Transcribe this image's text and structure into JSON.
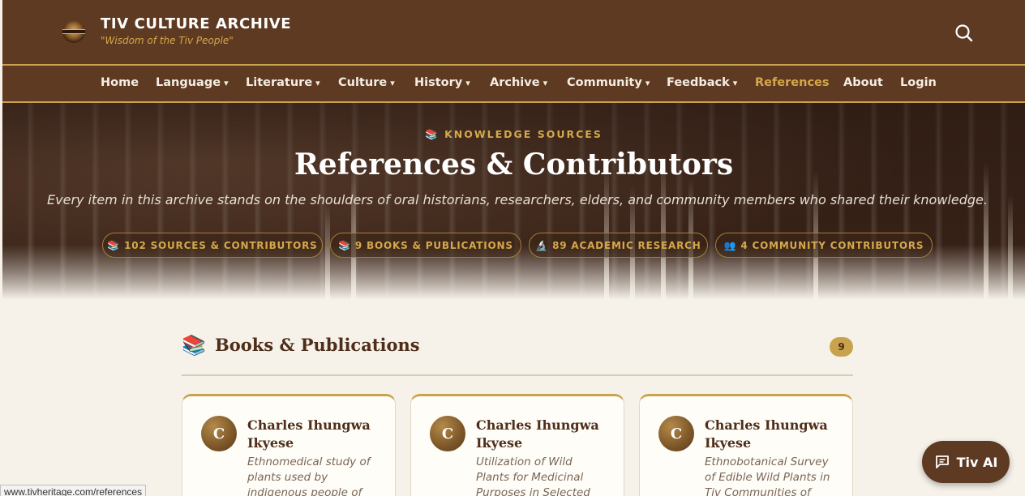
{
  "header": {
    "site_title": "TIV CULTURE ARCHIVE",
    "tagline": "\"Wisdom of the Tiv People\"",
    "logo_icon": "tiv-heritage-logo",
    "search_icon": "search-icon"
  },
  "nav": {
    "items": [
      {
        "label": "Home",
        "dropdown": false
      },
      {
        "label": "Language",
        "dropdown": true
      },
      {
        "label": "Literature",
        "dropdown": true
      },
      {
        "label": "Culture",
        "dropdown": true
      },
      {
        "label": "History",
        "dropdown": true
      },
      {
        "label": "Archive",
        "dropdown": true
      },
      {
        "label": "Community",
        "dropdown": true
      },
      {
        "label": "Feedback",
        "dropdown": true
      },
      {
        "label": "References",
        "dropdown": false,
        "active": true
      },
      {
        "label": "About",
        "dropdown": false
      },
      {
        "label": "Login",
        "dropdown": false
      }
    ],
    "caret": "▾"
  },
  "hero": {
    "kicker_icon": "📚",
    "kicker": "KNOWLEDGE SOURCES",
    "title": "References & Contributors",
    "subtitle": "Every item in this archive stands on the shoulders of oral historians, researchers, elders, and community members who shared their knowledge.",
    "stats": [
      {
        "icon": "📚",
        "label": "102 SOURCES & CONTRIBUTORS"
      },
      {
        "icon": "📚",
        "label": "9 BOOKS & PUBLICATIONS"
      },
      {
        "icon": "🔬",
        "label": "89 ACADEMIC RESEARCH"
      },
      {
        "icon": "👥",
        "label": "4 COMMUNITY CONTRIBUTORS"
      }
    ]
  },
  "section": {
    "icon": "📚",
    "title": "Books & Publications",
    "count": "9"
  },
  "cards": [
    {
      "initial": "C",
      "name": "Charles Ihungwa Ikyese",
      "desc": "Ethnomedical study of plants used by indigenous people of"
    },
    {
      "initial": "C",
      "name": "Charles Ihungwa Ikyese",
      "desc": "Utilization of Wild Plants for Medicinal Purposes in Selected Tiv"
    },
    {
      "initial": "C",
      "name": "Charles Ihungwa Ikyese",
      "desc": "Ethnobotanical Survey of Edible Wild Plants in Tiv Communities of Benue"
    }
  ],
  "ai_button": {
    "label": "Tiv AI",
    "icon": "chat-icon"
  },
  "status_bar": {
    "url": "www.tivheritage.com/references"
  },
  "colors": {
    "header_bg": "#5e3a22",
    "accent_gold": "#c9a24d",
    "page_bg": "#f6f2ea",
    "heading_brown": "#4e2e1a"
  }
}
